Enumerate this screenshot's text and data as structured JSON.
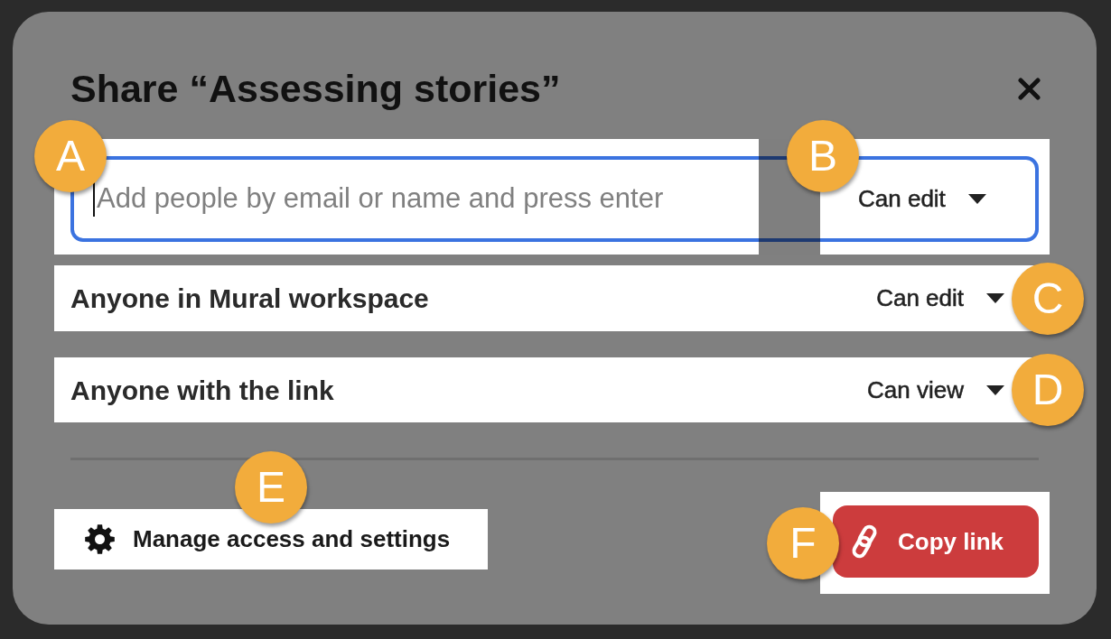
{
  "dialog": {
    "title": "Share “Assessing stories”"
  },
  "invite": {
    "placeholder": "Add people by email or name and press enter",
    "focused": true,
    "permission": "Can edit",
    "callout": "A",
    "permission_callout": "B"
  },
  "access_rows": [
    {
      "label": "Anyone in Mural workspace",
      "permission": "Can edit",
      "callout": "C"
    },
    {
      "label": "Anyone with the link",
      "permission": "Can view",
      "callout": "D"
    }
  ],
  "manage_button": {
    "label": "Manage access and settings",
    "callout": "E"
  },
  "copy_link_button": {
    "label": "Copy link",
    "callout": "F"
  }
}
